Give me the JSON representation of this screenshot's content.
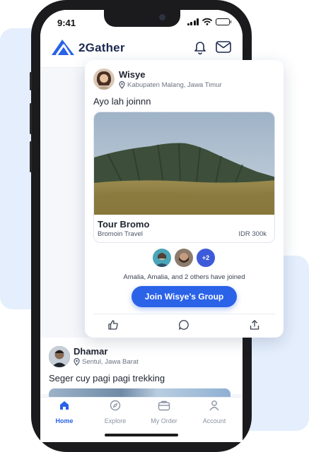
{
  "status_bar": {
    "time": "9:41"
  },
  "app": {
    "name": "2Gather"
  },
  "featured_post": {
    "user_name": "Wisye",
    "location": "Kabupaten Malang, Jawa Timur",
    "text": "Ayo lah joinnn",
    "trip": {
      "title": "Tour Bromo",
      "organizer": "Bromoin Travel",
      "price": "IDR 300k"
    },
    "joined_more_badge": "+2",
    "joined_text": "Amalia, Amalia, and 2 others have joined",
    "join_button_label": "Join Wisye’s Group"
  },
  "second_post": {
    "user_name": "Dhamar",
    "location": "Sentul, Jawa Barat",
    "text": "Seger cuy pagi pagi trekking"
  },
  "tabs": [
    {
      "label": "Home",
      "icon": "home-icon",
      "active": true
    },
    {
      "label": "Explore",
      "icon": "compass-icon",
      "active": false
    },
    {
      "label": "My Order",
      "icon": "bag-icon",
      "active": false
    },
    {
      "label": "Account",
      "icon": "user-icon",
      "active": false
    }
  ],
  "colors": {
    "accent": "#2a62e8",
    "brand_text": "#1e2a52",
    "background_blob": "#e4eefc"
  }
}
